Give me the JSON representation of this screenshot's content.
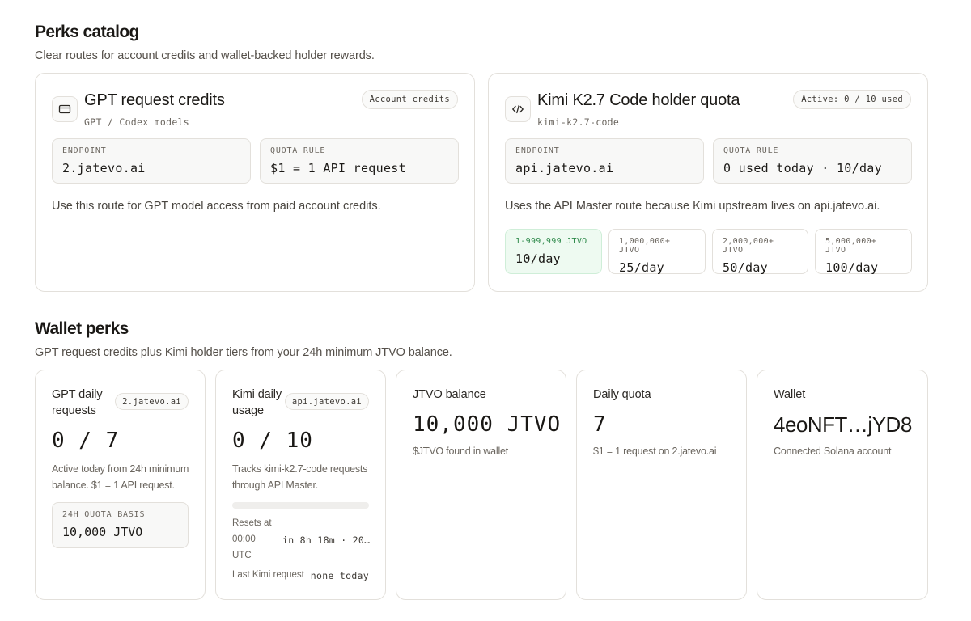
{
  "catalog": {
    "title": "Perks catalog",
    "subtitle": "Clear routes for account credits and wallet-backed holder rewards.",
    "gpt_card": {
      "icon": "credit-card-icon",
      "title": "GPT request credits",
      "slug": "GPT / Codex models",
      "pill": "Account credits",
      "endpoint_label": "ENDPOINT",
      "endpoint_value": "2.jatevo.ai",
      "quota_label": "QUOTA RULE",
      "quota_value": "$1 = 1 API request",
      "note": "Use this route for GPT model access from paid account credits."
    },
    "kimi_card": {
      "icon": "code-icon",
      "title": "Kimi K2.7 Code holder quota",
      "slug": "kimi-k2.7-code",
      "pill": "Active: 0 / 10 used",
      "endpoint_label": "ENDPOINT",
      "endpoint_value": "api.jatevo.ai",
      "quota_label": "QUOTA RULE",
      "quota_value": "0 used today · 10/day",
      "note": "Uses the API Master route because Kimi upstream lives on api.jatevo.ai.",
      "tiers": [
        {
          "range": "1-999,999 JTVO",
          "limit": "10/day",
          "active": true
        },
        {
          "range": "1,000,000+ JTVO",
          "limit": "25/day",
          "active": false
        },
        {
          "range": "2,000,000+ JTVO",
          "limit": "50/day",
          "active": false
        },
        {
          "range": "5,000,000+ JTVO",
          "limit": "100/day",
          "active": false
        }
      ],
      "active_color": "#eefaf1"
    }
  },
  "wallet": {
    "title": "Wallet perks",
    "subtitle": "GPT request credits plus Kimi holder tiers from your 24h minimum JTVO balance.",
    "gpt_daily": {
      "title": "GPT daily requests",
      "pill": "2.jatevo.ai",
      "value": "0 / 7",
      "desc": "Active today from 24h minimum balance. $1 = 1 API request.",
      "basis_label": "24H QUOTA BASIS",
      "basis_value": "10,000 JTVO"
    },
    "kimi_daily": {
      "title": "Kimi daily usage",
      "pill": "api.jatevo.ai",
      "value": "0 / 10",
      "desc": "Tracks kimi-k2.7-code requests through API Master.",
      "progress": 0,
      "resets_label": "Resets at",
      "resets_time": "00:00",
      "resets_tz": "UTC",
      "resets_in": "in 8h 18m · 20…",
      "last_label": "Last Kimi request",
      "last_value": "none today"
    },
    "balance": {
      "title": "JTVO balance",
      "value": "10,000 JTVO",
      "desc": "$JTVO found in wallet"
    },
    "quota": {
      "title": "Daily quota",
      "value": "7",
      "desc": "$1 = 1 request on 2.jatevo.ai"
    },
    "wallet": {
      "title": "Wallet",
      "value": "4eoNFT…jYD8",
      "desc": "Connected Solana account"
    }
  }
}
